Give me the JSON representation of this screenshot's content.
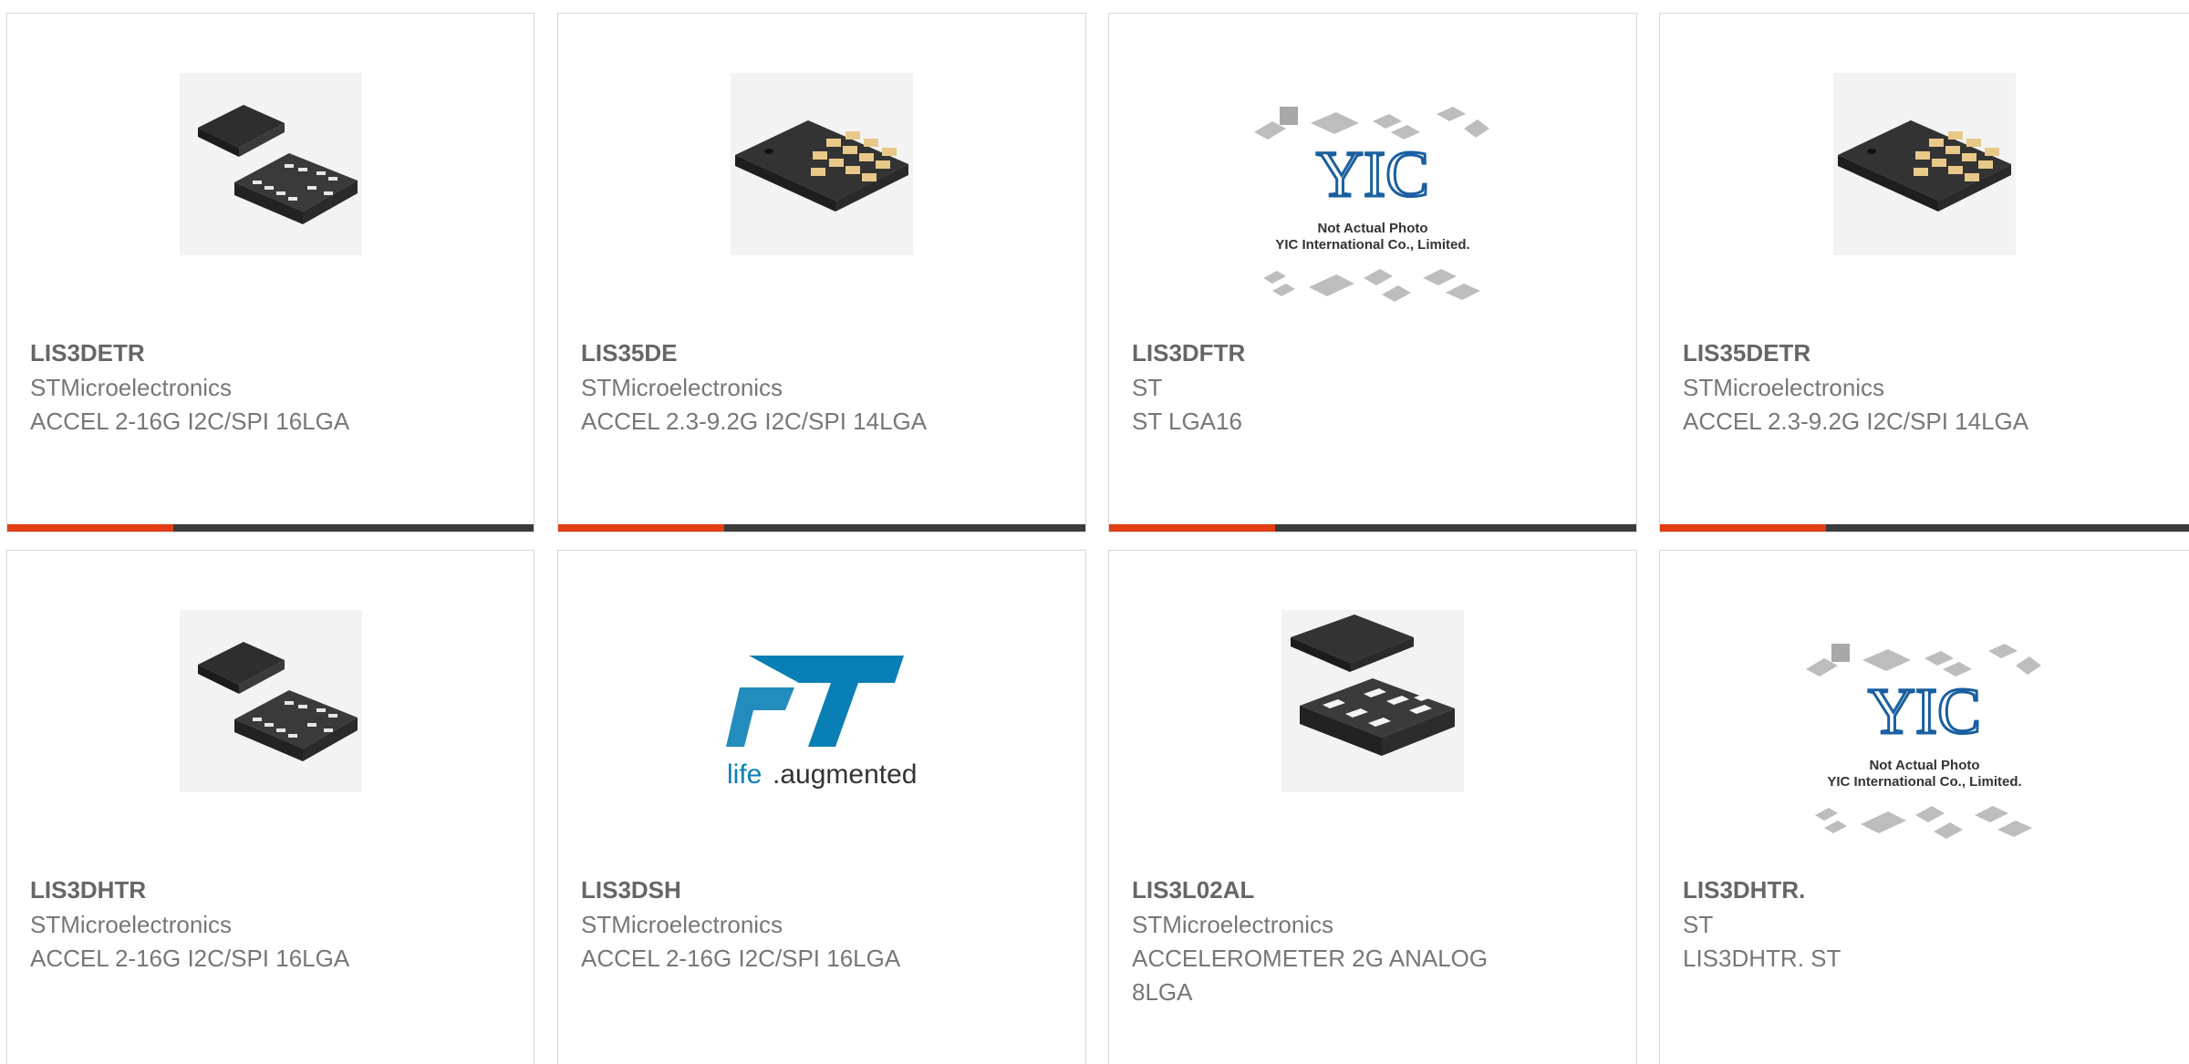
{
  "products": [
    {
      "part": "LIS3DETR",
      "brand": "STMicroelectronics",
      "desc": "ACCEL 2-16G I2C/SPI 16LGA",
      "image": "lga16-chip-icon"
    },
    {
      "part": "LIS35DE",
      "brand": "STMicroelectronics",
      "desc": "ACCEL 2.3-9.2G I2C/SPI 14LGA",
      "image": "lga14-chip-icon"
    },
    {
      "part": "LIS3DFTR",
      "brand": "ST",
      "desc": "ST LGA16",
      "image": "not-actual-photo-placeholder"
    },
    {
      "part": "LIS35DETR",
      "brand": "STMicroelectronics",
      "desc": "ACCEL 2.3-9.2G I2C/SPI 14LGA",
      "image": "lga14-chip-icon"
    },
    {
      "part": "LIS3DHTR",
      "brand": "STMicroelectronics",
      "desc": "ACCEL 2-16G I2C/SPI 16LGA",
      "image": "lga16-chip-icon"
    },
    {
      "part": "LIS3DSH",
      "brand": "STMicroelectronics",
      "desc": "ACCEL 2-16G I2C/SPI 16LGA",
      "image": "st-logo"
    },
    {
      "part": "LIS3L02AL",
      "brand": "STMicroelectronics",
      "desc": "ACCELEROMETER 2G ANALOG 8LGA",
      "image": "lga8-chip-icon"
    },
    {
      "part": "LIS3DHTR.",
      "brand": "ST",
      "desc": "LIS3DHTR. ST",
      "image": "not-actual-photo-placeholder"
    }
  ],
  "placeholder": {
    "logo": "YIC",
    "line1": "Not Actual Photo",
    "line2": "YIC International Co., Limited."
  },
  "st_logo": {
    "mark": "ST",
    "tagline_prefix": "life",
    "tagline_suffix": ".augmented"
  },
  "colors": {
    "accent": "#e23d14",
    "bar": "#3b3b3b",
    "title": "#666666",
    "text": "#777777",
    "st_blue": "#0a7fb5"
  }
}
